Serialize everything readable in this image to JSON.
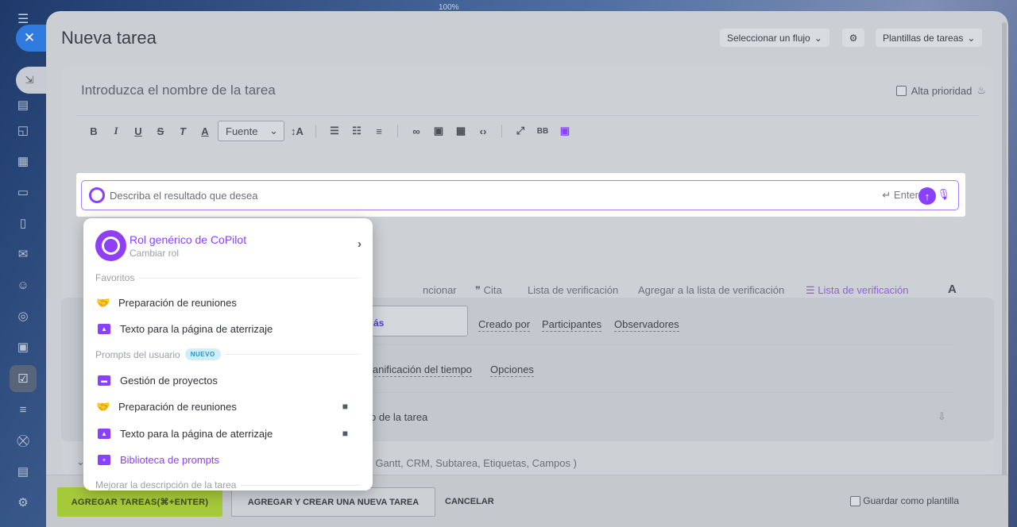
{
  "zoom_label": "100%",
  "window": {
    "title": "Nueva tarea"
  },
  "header": {
    "flow_select": "Seleccionar un flujo",
    "templates": "Plantillas de tareas"
  },
  "task": {
    "name_placeholder": "Introduzca el nombre de la tarea",
    "high_priority": "Alta prioridad"
  },
  "toolbar": {
    "font_select": "Fuente",
    "bbcode": "BB"
  },
  "copilot_input": {
    "placeholder": "Describa el resultado que desea",
    "enter_hint": "Enter"
  },
  "editor_actions": {
    "mention": "ncionar",
    "quote": "Cita",
    "checklist": "Lista de verificación",
    "add_to_checklist": "Agregar a la lista de verificación",
    "checklist_ai": "Lista de verificación",
    "font_letter": "A"
  },
  "people": {
    "more_fragment": "ás",
    "created_by": "Creado por",
    "participants": "Participantes",
    "observers": "Observadores"
  },
  "time": {
    "planning": "lanificación del tiempo",
    "options": "Opciones"
  },
  "task_fragment": "o de la tarea",
  "more_links": "tir,  Gantt,  CRM,  Subtarea,  Etiquetas,  Campos )",
  "popup": {
    "role_name": "Rol genérico de CoPilot",
    "role_change": "Cambiar rol",
    "favorites_label": "Favoritos",
    "favorites": [
      {
        "label": "Preparación de reuniones"
      },
      {
        "label": "Texto para la página de aterrizaje"
      }
    ],
    "user_prompts_label": "Prompts del usuario",
    "new_badge": "NUEVO",
    "user_prompts": [
      {
        "label": "Gestión de proyectos"
      },
      {
        "label": "Preparación de reuniones"
      },
      {
        "label": "Texto para la página de aterrizaje"
      }
    ],
    "library": "Biblioteca de prompts",
    "improve_label": "Mejorar la descripción de la tarea"
  },
  "footer": {
    "add_tasks": "AGREGAR TAREAS(⌘+ENTER)",
    "add_and_create": "AGREGAR Y CREAR UNA NUEVA TAREA",
    "cancel": "CANCELAR",
    "save_template": "Guardar como plantilla"
  },
  "colors": {
    "accent": "#8b3fff",
    "primary_button": "#a6c93a",
    "close_button": "#2f7be0"
  }
}
